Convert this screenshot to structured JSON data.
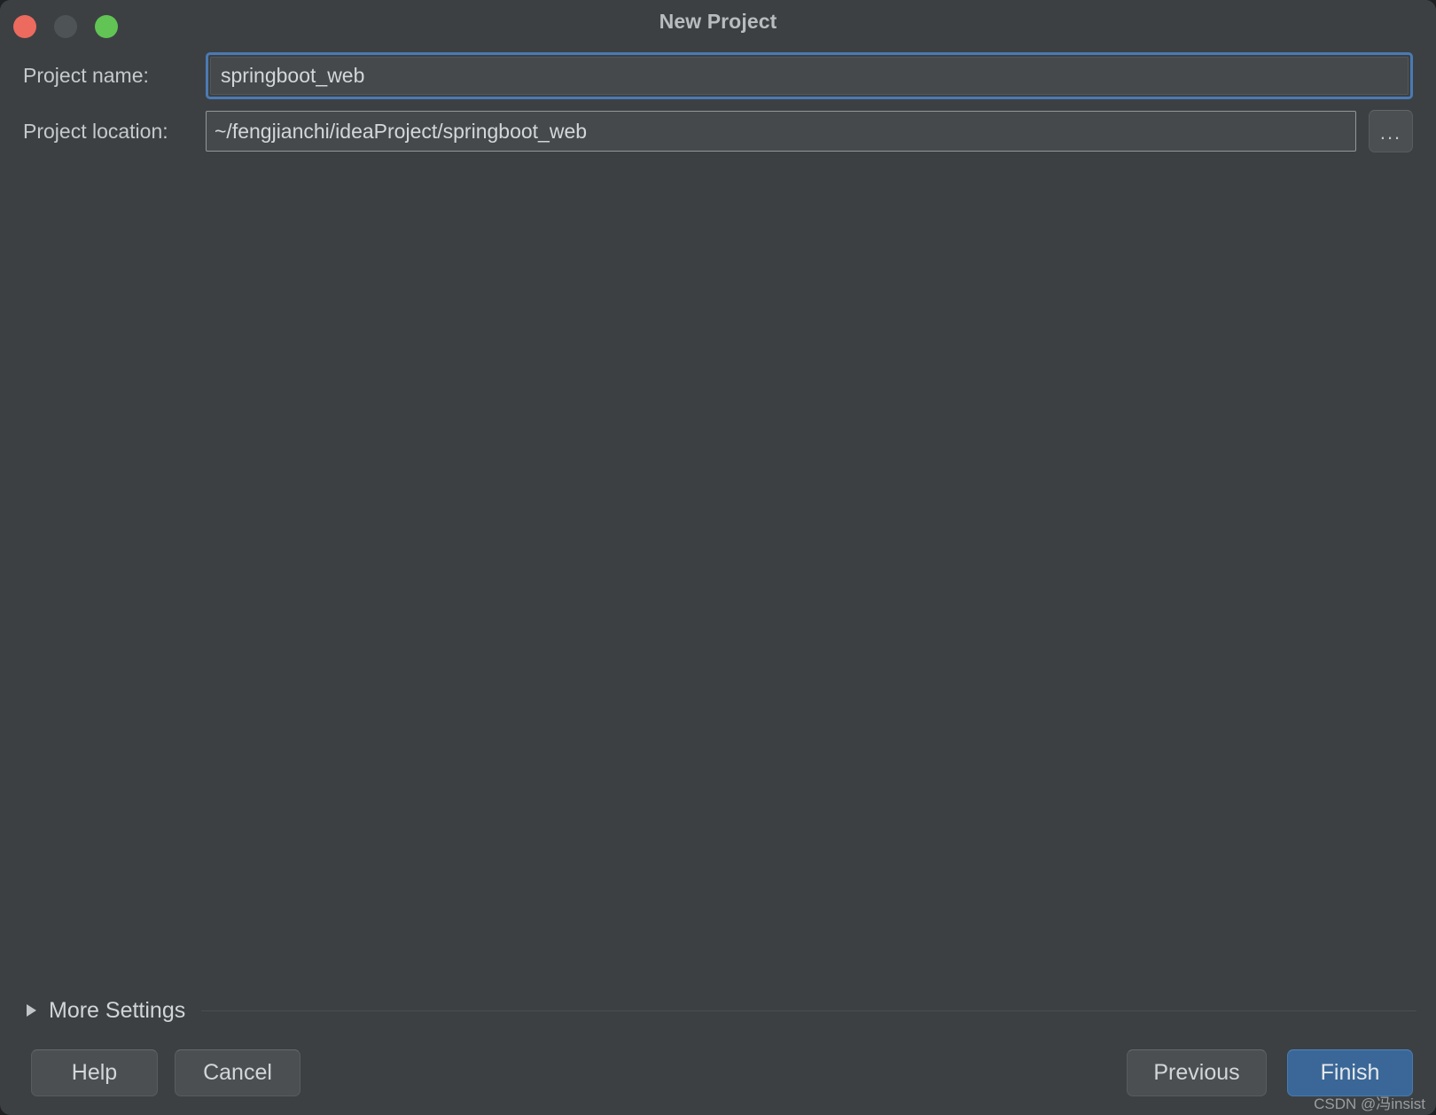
{
  "window": {
    "title": "New Project",
    "traffic_lights": [
      {
        "name": "close",
        "color": "#ec6a5e"
      },
      {
        "name": "minimize",
        "color": "#4e5356"
      },
      {
        "name": "maximize",
        "color": "#61c454"
      }
    ],
    "background_color": "#3c4043"
  },
  "form": {
    "project_name": {
      "label": "Project name:",
      "value": "springboot_web",
      "placeholder": "",
      "focused": true,
      "focus_color": "#4a7ab4"
    },
    "project_location": {
      "label": "Project location:",
      "value": "~/fengjianchi/ideaProject/springboot_web",
      "placeholder": "",
      "browse_label": "..."
    }
  },
  "more_settings": {
    "label": "More Settings",
    "expanded": false,
    "arrow_icon": "triangle-right-icon"
  },
  "footer": {
    "help_label": "Help",
    "cancel_label": "Cancel",
    "previous_label": "Previous",
    "finish_label": "Finish",
    "default_button": "Finish",
    "default_button_color": "#3a6797"
  },
  "watermark": {
    "text": "CSDN @冯insist"
  }
}
